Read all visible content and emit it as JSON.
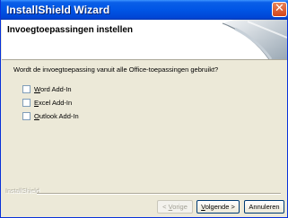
{
  "window": {
    "title": "InstallShield Wizard",
    "close_glyph": "✕"
  },
  "header": {
    "title": "Invoegtoepassingen instellen"
  },
  "question": "Wordt de invoegtoepassing vanuit alle Office-toepassingen gebruikt?",
  "options": [
    {
      "mnemonic": "W",
      "rest": "ord Add-In",
      "checked": false
    },
    {
      "mnemonic": "E",
      "rest": "xcel Add-In",
      "checked": false
    },
    {
      "mnemonic": "O",
      "rest": "utlook Add-In",
      "checked": false
    }
  ],
  "brand": "InstallShield",
  "buttons": {
    "back": {
      "prefix": "< ",
      "mnemonic": "V",
      "suffix": "orige",
      "disabled": true
    },
    "next": {
      "prefix": "",
      "mnemonic": "V",
      "suffix": "olgende >",
      "disabled": false
    },
    "cancel": {
      "label": "Annuleren",
      "disabled": false
    }
  }
}
